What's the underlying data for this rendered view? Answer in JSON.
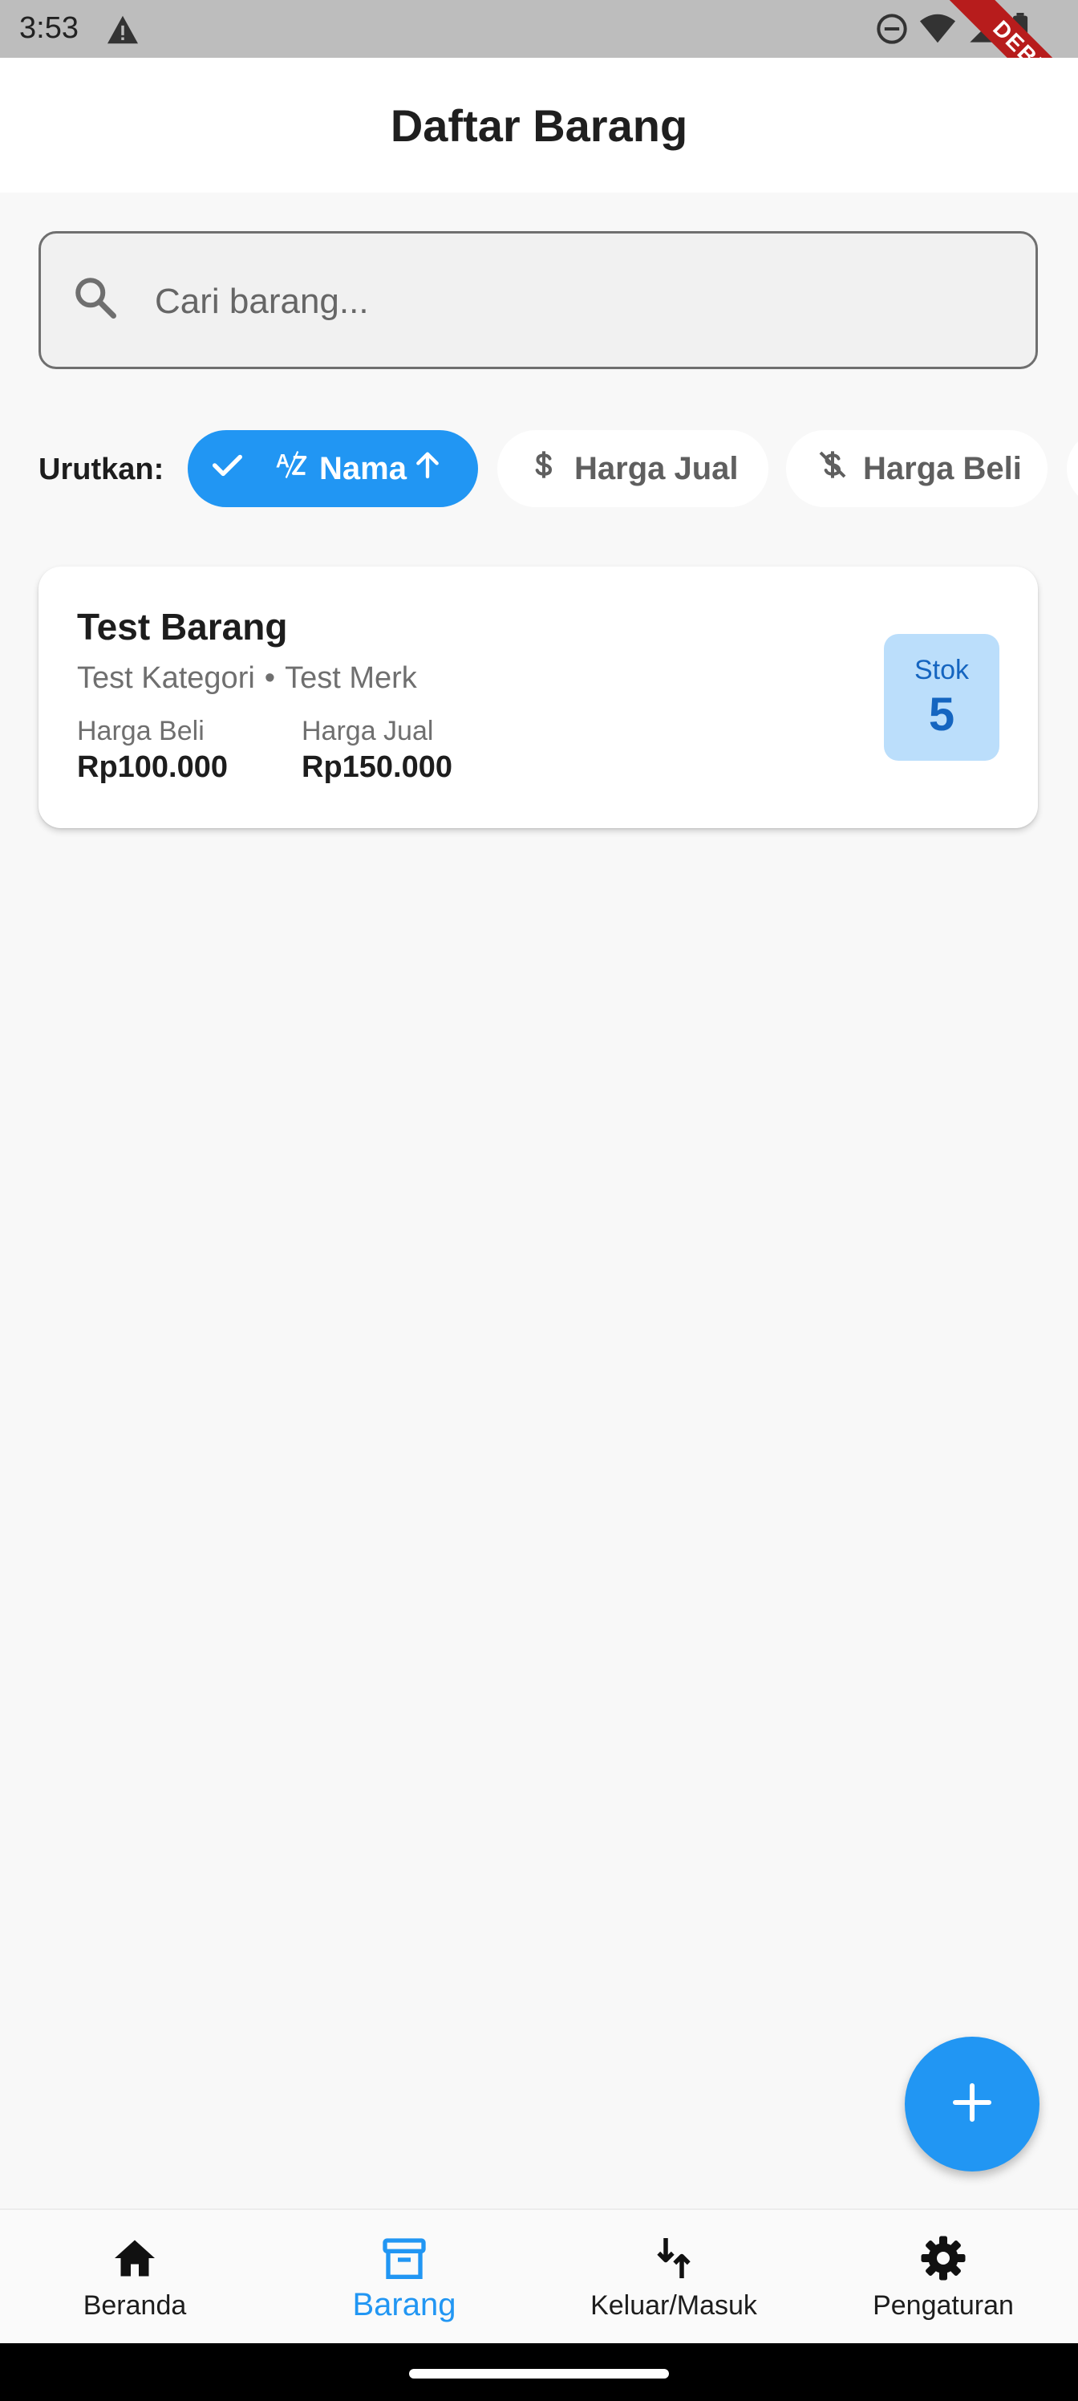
{
  "status_bar": {
    "time": "3:53",
    "icons": [
      "warning-icon",
      "do-not-disturb-icon",
      "wifi-icon",
      "signal-icon",
      "battery-icon"
    ]
  },
  "debug_banner": {
    "text": "DEBUG"
  },
  "app_bar": {
    "title": "Daftar Barang"
  },
  "search": {
    "placeholder": "Cari barang...",
    "value": ""
  },
  "sort": {
    "label": "Urutkan:",
    "chips": [
      {
        "label": "Nama",
        "icon": "sort-by-alpha-icon",
        "selected": true,
        "direction": "ascending"
      },
      {
        "label": "Harga Jual",
        "icon": "dollar-icon",
        "selected": false
      },
      {
        "label": "Harga Beli",
        "icon": "money-off-icon",
        "selected": false
      }
    ]
  },
  "items": [
    {
      "name": "Test Barang",
      "category": "Test Kategori",
      "separator": "•",
      "brand": "Test Merk",
      "harga_beli_label": "Harga Beli",
      "harga_beli": "Rp100.000",
      "harga_jual_label": "Harga Jual",
      "harga_jual": "Rp150.000",
      "stok_label": "Stok",
      "stok": "5"
    }
  ],
  "fab": {
    "icon": "add-icon"
  },
  "bottom_nav": {
    "items": [
      {
        "label": "Beranda",
        "icon": "home-icon",
        "active": false
      },
      {
        "label": "Barang",
        "icon": "inventory-box-icon",
        "active": true
      },
      {
        "label": "Keluar/Masuk",
        "icon": "swap-vert-icon",
        "active": false
      },
      {
        "label": "Pengaturan",
        "icon": "settings-icon",
        "active": false
      }
    ]
  },
  "colors": {
    "primary": "#2196f3",
    "stock_badge_bg": "#bbdefb",
    "stock_text": "#1565c0",
    "debug_ribbon": "#b71c1c"
  }
}
